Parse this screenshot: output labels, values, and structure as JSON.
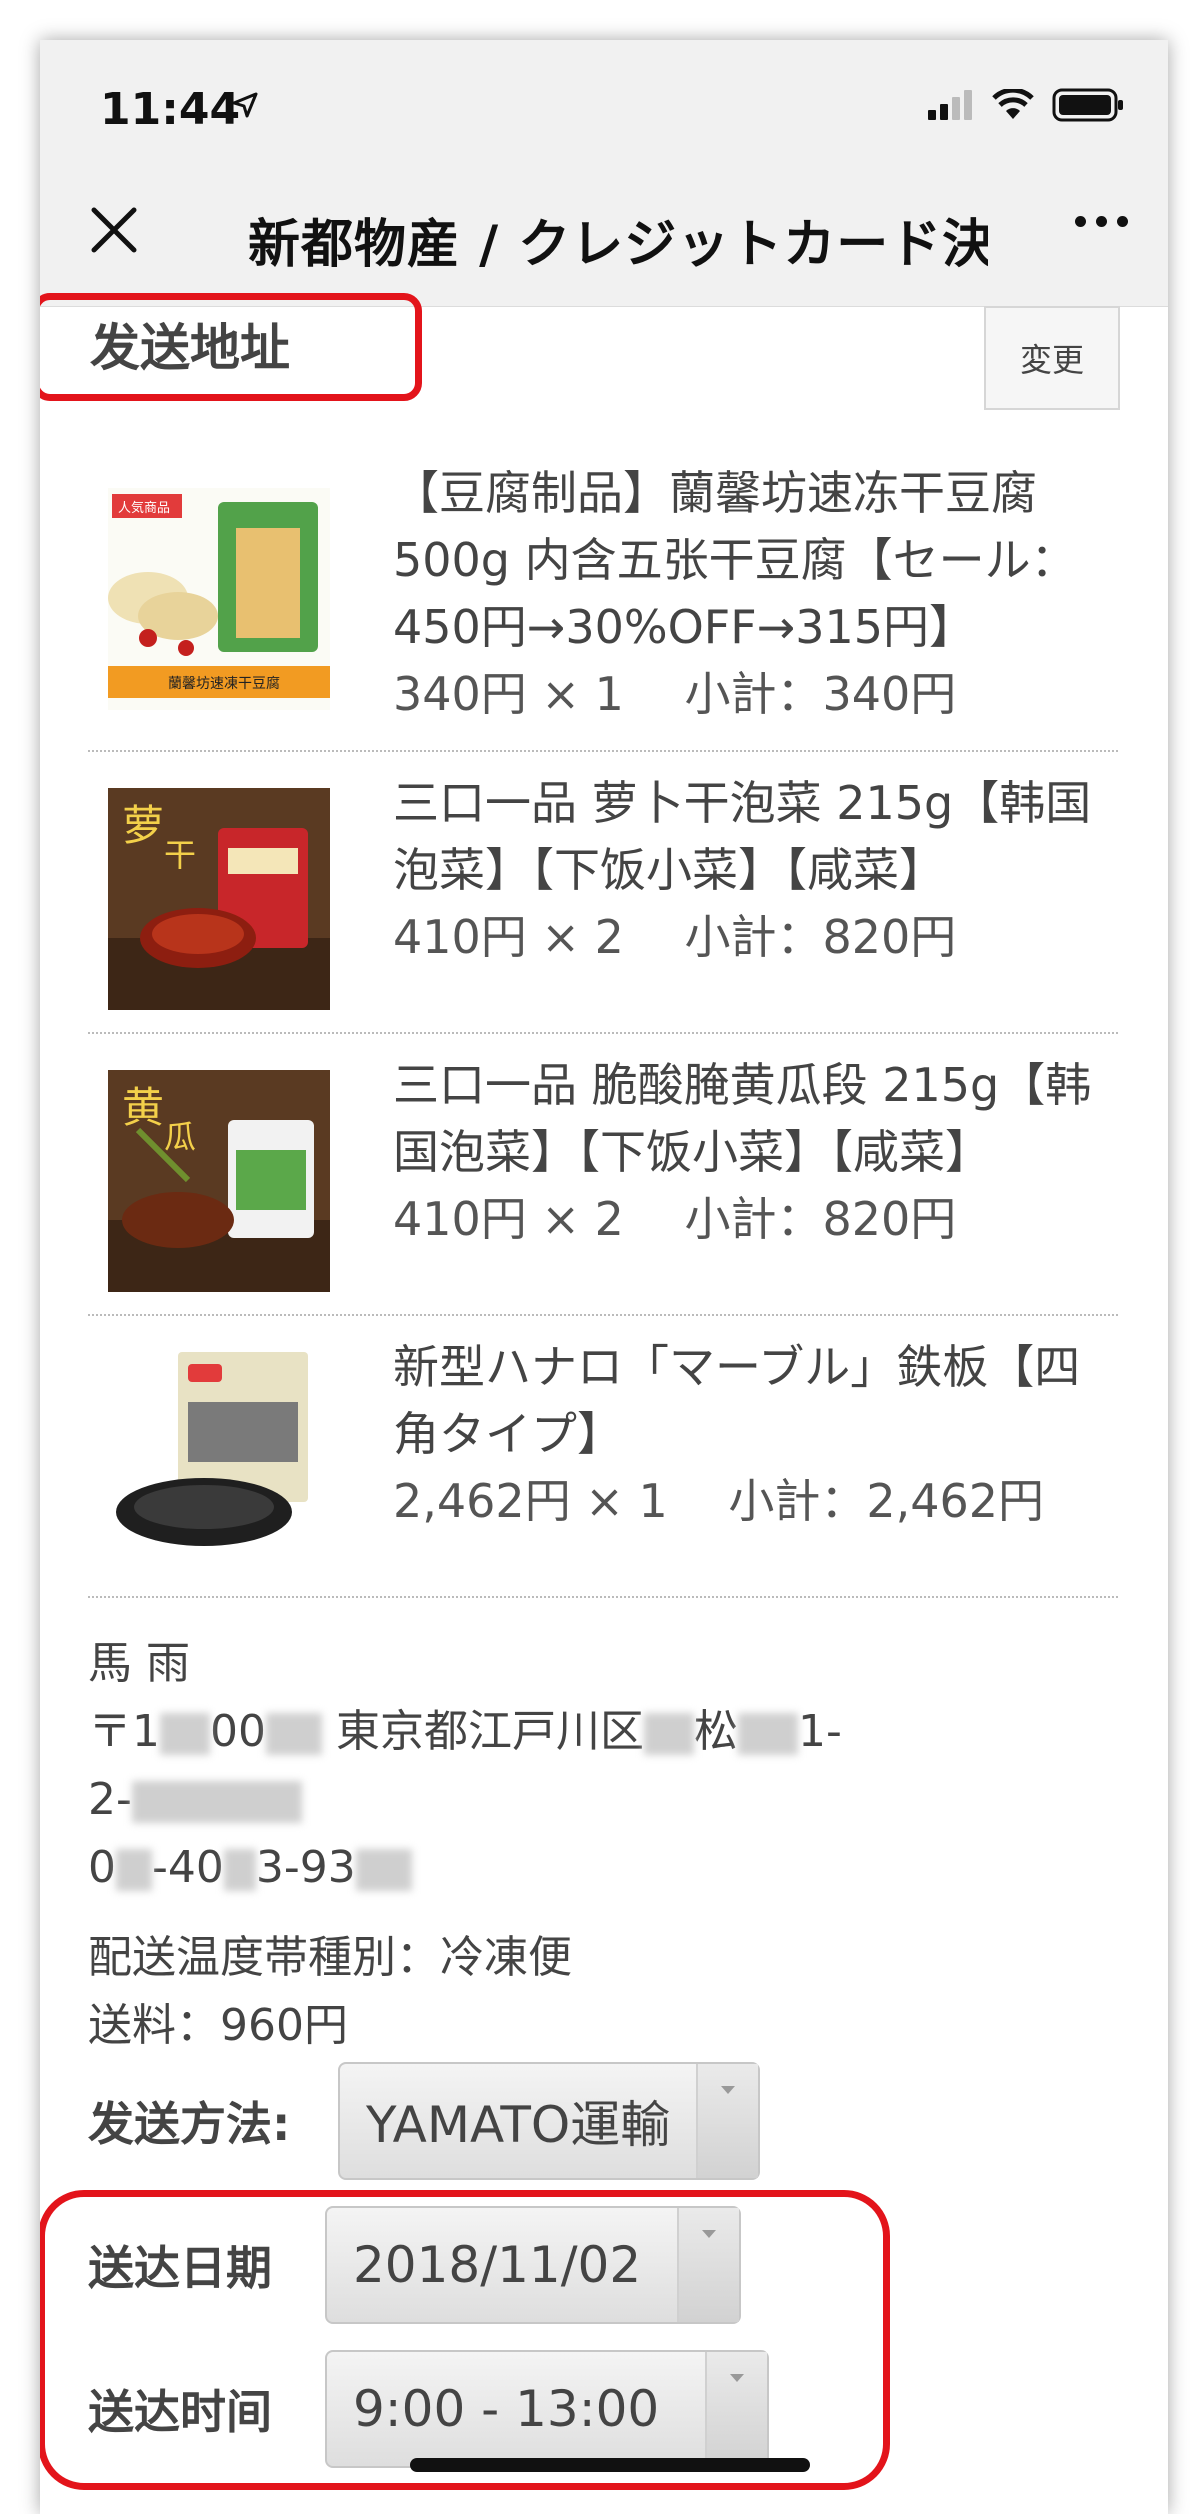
{
  "status_bar": {
    "time": "11:44"
  },
  "nav": {
    "title": "新都物産 / クレジットカード決済"
  },
  "address_section": {
    "header": "发送地址",
    "change_label": "変更"
  },
  "items": [
    {
      "name": "【豆腐制品】蘭馨坊速冻干豆腐500g 内含五张干豆腐【セール：450円→30%OFF→315円】",
      "line1": "【豆腐制品】蘭馨坊速冻干豆腐",
      "line2": "500g 内含五张干豆腐【セール：",
      "line3": "450円→30%OFF→315円】",
      "price": "340円 × 1　 小計：340円",
      "image": "dried-tofu-product-image"
    },
    {
      "line1": "三口一品 萝卜干泡菜 215g【韩国",
      "line2": "泡菜】【下饭小菜】【咸菜】",
      "price": "410円 × 2　 小計：820円",
      "image": "radish-kimchi-product-image"
    },
    {
      "line1": "三口一品 脆酸腌黄瓜段 215g【韩",
      "line2": "国泡菜】【下饭小菜】【咸菜】",
      "price": "410円 × 2　 小計：820円",
      "image": "pickled-cucumber-product-image"
    },
    {
      "line1": "新型ハナロ「マーブル」鉄板【四",
      "line2": "角タイプ】",
      "price": "2,462円 × 1　 小計：2,462円",
      "image": "grill-plate-product-image"
    }
  ],
  "recipient": {
    "name": "馬 雨",
    "postal_prefix": "〒1",
    "postal_mid": "00",
    "address_text": "東京都江戸川区",
    "address_mid": "松",
    "address_suffix": "1-",
    "line2": "2-",
    "phone_a": "0",
    "phone_b": "-40",
    "phone_c": "3-93"
  },
  "shipping": {
    "temperature": "配送温度帯種別：冷凍便",
    "fee": "送料：960円"
  },
  "form": {
    "method_label": "发送方法:",
    "method_value": "YAMATO運輸",
    "date_label": "送达日期",
    "date_value": "2018/11/02",
    "time_label": "送达时间",
    "time_value": "9:00 - 13:00"
  },
  "colors": {
    "highlight": "#e3141b",
    "topbar": "#f1f1f1"
  }
}
